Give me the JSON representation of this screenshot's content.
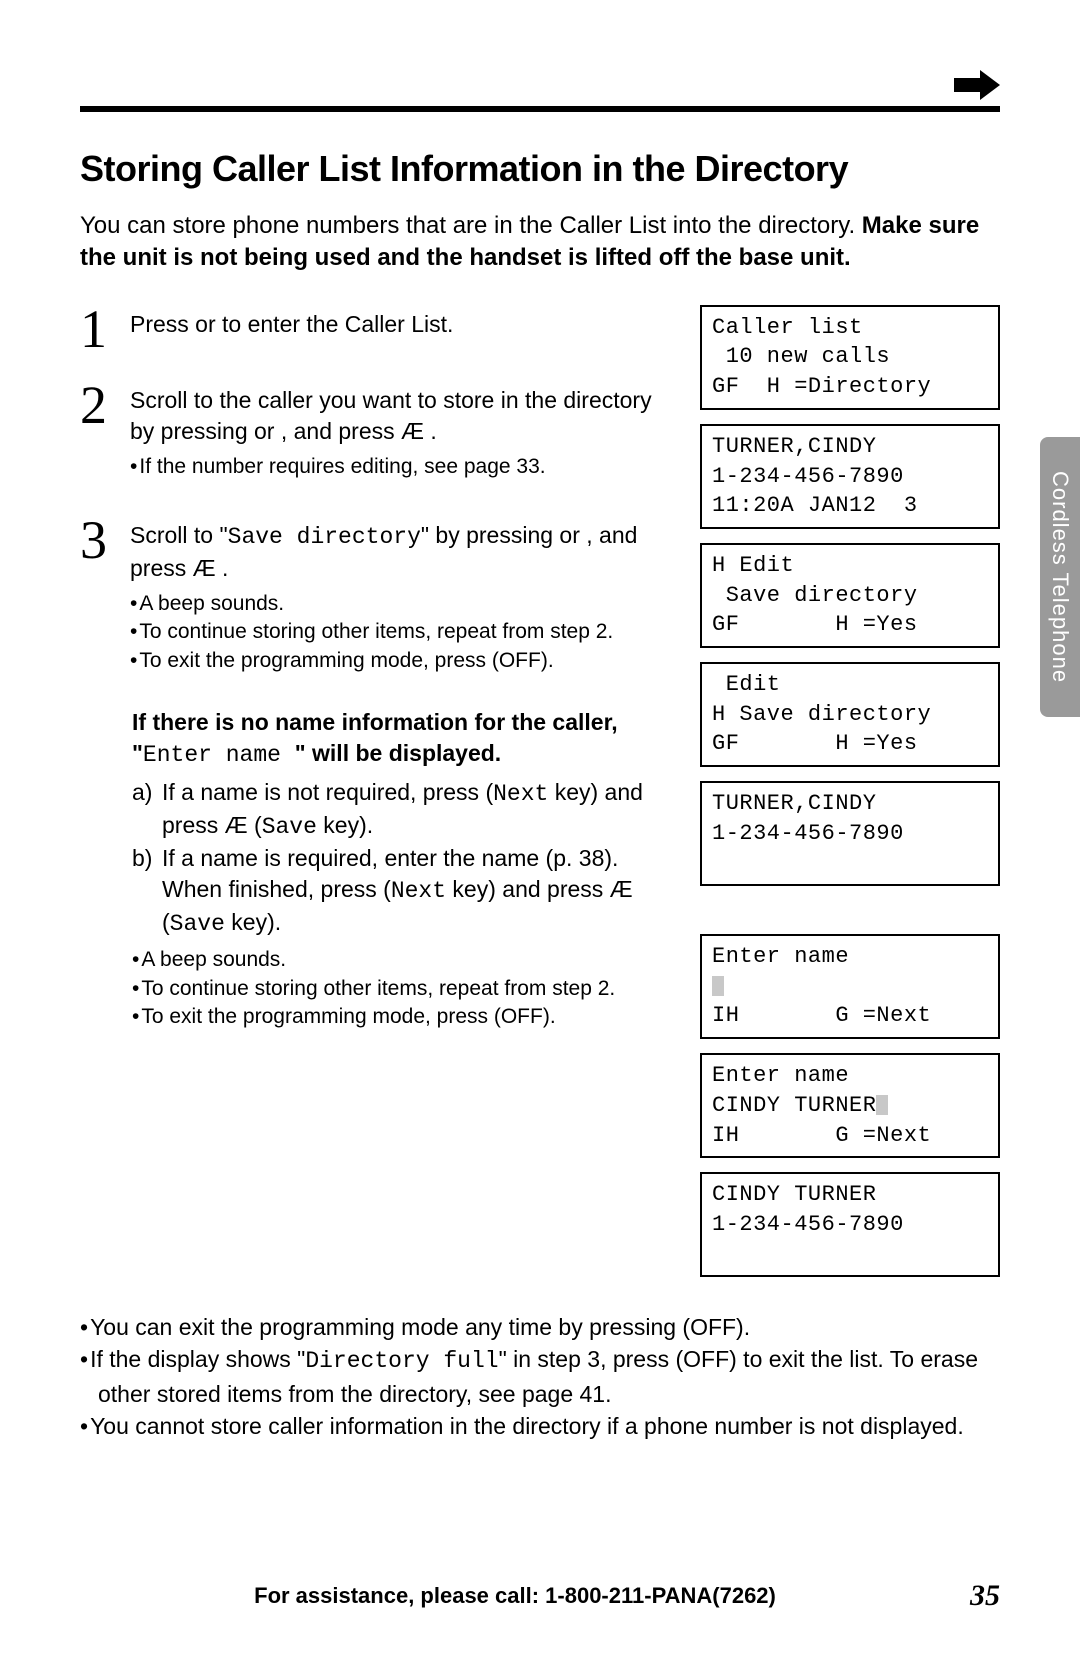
{
  "title": "Storing Caller List Information in the Directory",
  "intro_plain": "You can store phone numbers that are in the Caller List into the directory.",
  "intro_bold": "Make sure the unit is not being used and the handset is lifted off the base unit.",
  "steps": {
    "s1": {
      "num": "1",
      "text": "Press      or      to enter the Caller List."
    },
    "s2": {
      "num": "2",
      "line1": "Scroll to the caller you want to store in the directory by pressing      or     , and press Æ .",
      "bullet1": "If the number requires editing, see page 33."
    },
    "s3": {
      "num": "3",
      "line_pre": "Scroll to \"",
      "line_mono": "Save directory",
      "line_post": "\" by pressing      or     , and press Æ .",
      "bullet1": "A beep sounds.",
      "bullet2": "To continue storing other items, repeat from step 2.",
      "bullet3": "To exit the programming mode, press (OFF)."
    },
    "noname": {
      "bold_pre": "If there is no name information for the caller, \"",
      "mono": "Enter name  ",
      "bold_post": "\" will be displayed.",
      "a_lab": "a)",
      "a_text_pre": "If a name is not required, press      (",
      "a_next": "Next",
      "a_text_mid": " key) and press Æ  (",
      "a_save": "Save",
      "a_text_post": " key).",
      "b_lab": "b)",
      "b_text_pre": "If a name is required, enter the name (p. 38). When finished, press      (",
      "b_next": "Next",
      "b_text_mid": " key) and press Æ  (",
      "b_save": "Save",
      "b_text_post": " key).",
      "bullet1": "A beep sounds.",
      "bullet2": "To continue storing other items, repeat from step 2.",
      "bullet3": "To exit the programming mode, press (OFF)."
    }
  },
  "lcds": {
    "d1": "Caller list\n 10 new calls\nGF  H =Directory",
    "d2": "TURNER,CINDY\n1-234-456-7890\n11:20A JAN12  3",
    "d3": "H Edit\n Save directory\nGF       H =Yes",
    "d4": " Edit\nH Save directory\nGF       H =Yes",
    "d5": "TURNER,CINDY\n1-234-456-7890\n ",
    "d6a": "Enter name",
    "d6c": "IH       G =Next",
    "d7a": "Enter name",
    "d7b": "CINDY TURNER",
    "d7c": "IH       G =Next",
    "d8": "CINDY TURNER\n1-234-456-7890\n "
  },
  "notes": {
    "n1": "You can exit the programming mode any time by pressing (OFF).",
    "n2_pre": "If the display shows \"",
    "n2_mono": "Directory full",
    "n2_post": "\" in step 3, press (OFF) to exit the list. To erase other stored items from the directory, see page 41.",
    "n3": "You cannot store caller information in the directory if a phone number is not displayed."
  },
  "sidetab": "Cordless Telephone",
  "footer": "For assistance, please call: 1-800-211-PANA(7262)",
  "pagenum": "35"
}
